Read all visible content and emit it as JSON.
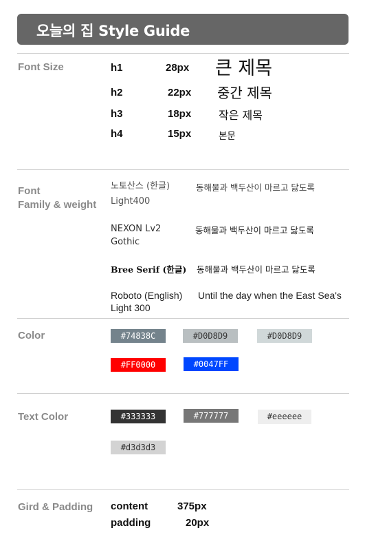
{
  "header": {
    "title": "오늘의 집 Style Guide"
  },
  "font_size": {
    "label": "Font Size",
    "rows": [
      {
        "tag": "h1",
        "size": "28px",
        "sample": "큰 제목"
      },
      {
        "tag": "h2",
        "size": "22px",
        "sample": "중간 제목"
      },
      {
        "tag": "h3",
        "size": "18px",
        "sample": "작은 제목"
      },
      {
        "tag": "h4",
        "size": "15px",
        "sample": "본문"
      }
    ]
  },
  "font_family": {
    "label_line1": "Font",
    "label_line2": "Family & weight",
    "rows": [
      {
        "name_line1": "노토산스 (한글)",
        "name_line2": "Light400",
        "sample": "동해물과 백두산이 마르고 닳도록"
      },
      {
        "name_line1": "NEXON Lv2",
        "name_line2": "Gothic",
        "sample": "동해물과 백두산이 마르고 닳도록"
      },
      {
        "name_line1": "Bree Serif (한글)",
        "name_line2": "",
        "sample": "동해물과 백두산이 마르고 닳도록"
      },
      {
        "name_line1": "Roboto (English)",
        "name_line2": "Light 300",
        "sample": "Until the day when the East Sea's"
      }
    ]
  },
  "color": {
    "label": "Color",
    "swatches": [
      {
        "hex": "#74838C",
        "bg": "#74838C",
        "fg": "#ffffff"
      },
      {
        "hex": "#D0D8D9",
        "bg": "#b9bfc1",
        "fg": "#333333"
      },
      {
        "hex": "#D0D8D9",
        "bg": "#d0d8d9",
        "fg": "#333333"
      },
      {
        "hex": "#FF0000",
        "bg": "#FF0000",
        "fg": "#ffffff"
      },
      {
        "hex": "#0047FF",
        "bg": "#0047FF",
        "fg": "#ffffff"
      }
    ]
  },
  "text_color": {
    "label": "Text Color",
    "swatches": [
      {
        "hex": "#333333",
        "bg": "#333333",
        "fg": "#ffffff"
      },
      {
        "hex": "#777777",
        "bg": "#777777",
        "fg": "#ffffff"
      },
      {
        "hex": "#eeeeee",
        "bg": "#eeeeee",
        "fg": "#333333"
      },
      {
        "hex": "#d3d3d3",
        "bg": "#d3d3d3",
        "fg": "#333333"
      }
    ]
  },
  "grid": {
    "label": "Gird & Padding",
    "rows": [
      {
        "key": "content",
        "value": "375px"
      },
      {
        "key": "padding",
        "value": "20px"
      }
    ]
  }
}
